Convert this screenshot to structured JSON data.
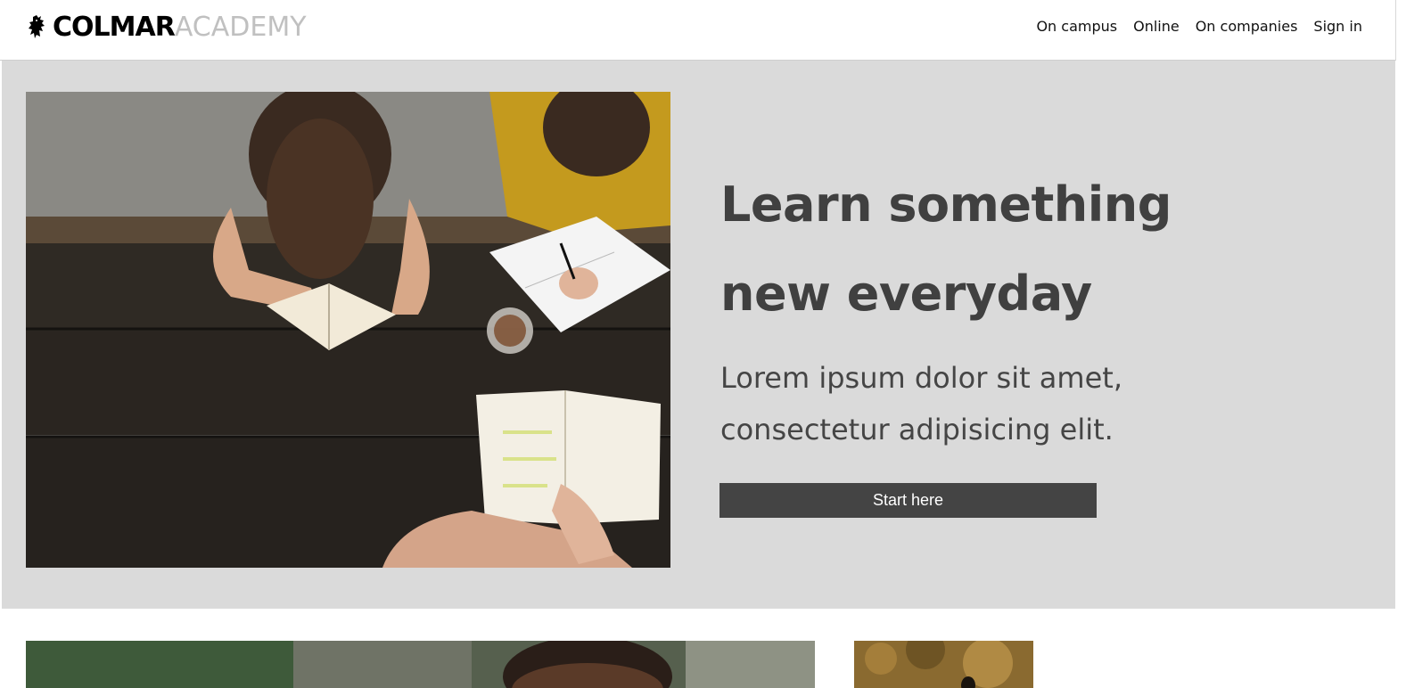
{
  "brand": {
    "name_bold": "COLMAR",
    "name_light": "ACADEMY",
    "icon": "griffin-icon"
  },
  "nav": {
    "items": [
      {
        "label": "On campus"
      },
      {
        "label": "Online"
      },
      {
        "label": "On companies"
      },
      {
        "label": "Sign in"
      }
    ]
  },
  "hero": {
    "heading_line1": "Learn something",
    "heading_line2": "new everyday",
    "subtext_line1": "Lorem ipsum dolor sit amet,",
    "subtext_line2": "consectetur adipisicing elit.",
    "button_label": "Start here"
  },
  "colors": {
    "hero_bg": "#dadada",
    "heading": "#404040",
    "button_bg": "#444444",
    "logo_light": "#c0c0c0"
  }
}
